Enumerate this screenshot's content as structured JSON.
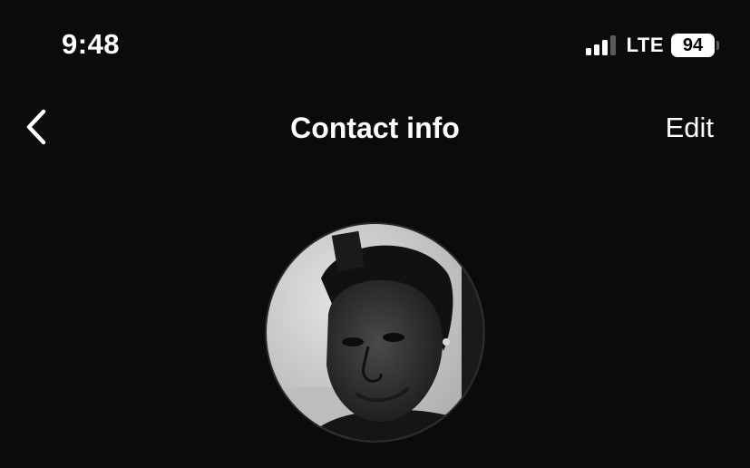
{
  "status_bar": {
    "time": "9:48",
    "network": "LTE",
    "battery": "94",
    "signal_bars_active": 3,
    "signal_bars_total": 4,
    "icons": [
      "signal-icon",
      "battery-icon"
    ]
  },
  "nav": {
    "back_icon": "chevron-left-icon",
    "title": "Contact info",
    "edit_label": "Edit"
  },
  "profile": {
    "avatar": "profile-photo"
  },
  "colors": {
    "background": "#0b0b0b",
    "text": "#ffffff",
    "battery_fill": "#ffffff",
    "signal_dim": "#5a5a5a"
  }
}
